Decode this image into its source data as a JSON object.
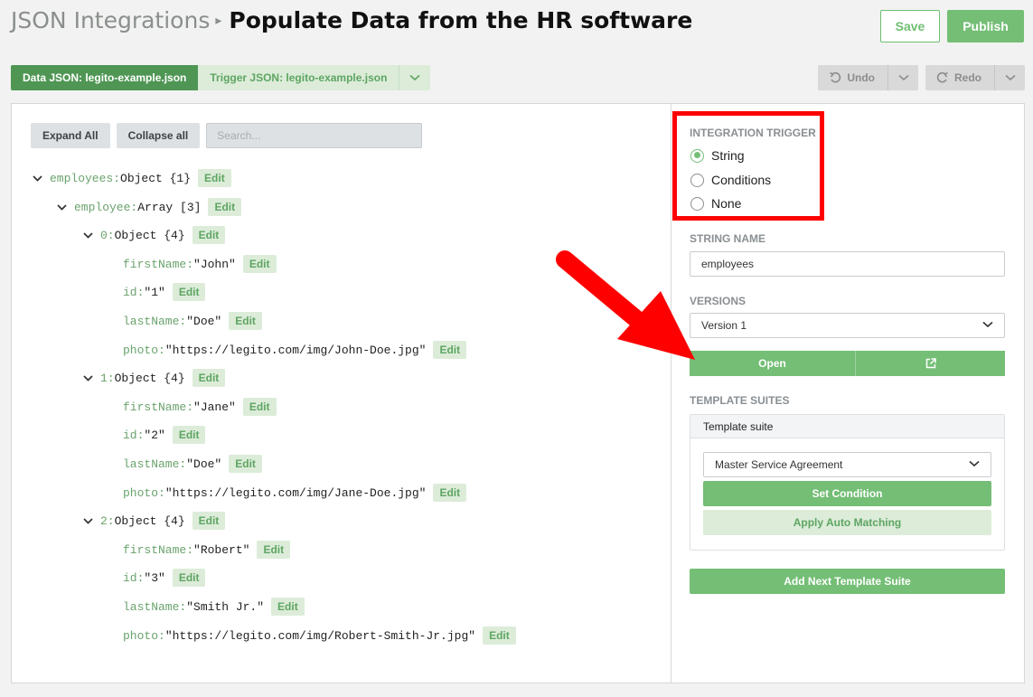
{
  "header": {
    "breadcrumb": "JSON Integrations",
    "title": "Populate Data from the HR software",
    "save_label": "Save",
    "publish_label": "Publish"
  },
  "tabs": [
    {
      "label": "Data JSON: legito-example.json",
      "active": true
    },
    {
      "label": "Trigger JSON: legito-example.json",
      "active": false
    }
  ],
  "toolbar": {
    "undo_label": "Undo",
    "redo_label": "Redo"
  },
  "tree_toolbar": {
    "expand_all": "Expand All",
    "collapse_all": "Collapse all",
    "search_placeholder": "Search..."
  },
  "tree": {
    "edit_label": "Edit",
    "nodes": [
      {
        "key": "employees:",
        "value": "Object {1}",
        "depth": 0,
        "chevron": true
      },
      {
        "key": "employee:",
        "value": "Array [3]",
        "depth": 1,
        "chevron": true
      },
      {
        "key": "0:",
        "value": "Object {4}",
        "depth": 2,
        "chevron": true
      },
      {
        "key": "firstName:",
        "value": "\"John\"",
        "depth": 3,
        "chevron": false
      },
      {
        "key": "id:",
        "value": "\"1\"",
        "depth": 3,
        "chevron": false
      },
      {
        "key": "lastName:",
        "value": "\"Doe\"",
        "depth": 3,
        "chevron": false
      },
      {
        "key": "photo:",
        "value": "\"https://legito.com/img/John-Doe.jpg\"",
        "depth": 3,
        "chevron": false
      },
      {
        "key": "1:",
        "value": "Object {4}",
        "depth": 2,
        "chevron": true
      },
      {
        "key": "firstName:",
        "value": "\"Jane\"",
        "depth": 3,
        "chevron": false
      },
      {
        "key": "id:",
        "value": "\"2\"",
        "depth": 3,
        "chevron": false
      },
      {
        "key": "lastName:",
        "value": "\"Doe\"",
        "depth": 3,
        "chevron": false
      },
      {
        "key": "photo:",
        "value": "\"https://legito.com/img/Jane-Doe.jpg\"",
        "depth": 3,
        "chevron": false
      },
      {
        "key": "2:",
        "value": "Object {4}",
        "depth": 2,
        "chevron": true
      },
      {
        "key": "firstName:",
        "value": "\"Robert\"",
        "depth": 3,
        "chevron": false
      },
      {
        "key": "id:",
        "value": "\"3\"",
        "depth": 3,
        "chevron": false
      },
      {
        "key": "lastName:",
        "value": "\"Smith Jr.\"",
        "depth": 3,
        "chevron": false
      },
      {
        "key": "photo:",
        "value": "\"https://legito.com/img/Robert-Smith-Jr.jpg\"",
        "depth": 3,
        "chevron": false
      }
    ]
  },
  "integration_trigger": {
    "label": "INTEGRATION TRIGGER",
    "options": [
      {
        "label": "String",
        "selected": true
      },
      {
        "label": "Conditions",
        "selected": false
      },
      {
        "label": "None",
        "selected": false
      }
    ]
  },
  "string_name": {
    "label": "STRING NAME",
    "value": "employees"
  },
  "versions": {
    "label": "VERSIONS",
    "selected": "Version 1",
    "open_label": "Open"
  },
  "template_suites": {
    "label": "TEMPLATE SUITES",
    "suite_title": "Template suite",
    "selected": "Master Service Agreement",
    "set_condition": "Set Condition",
    "auto_matching": "Apply Auto Matching",
    "add_next": "Add Next Template Suite"
  },
  "colors": {
    "accent": "#74be76",
    "accent_dark": "#4f9654",
    "annotation": "#ff0000"
  },
  "icons": {
    "undo": "undo-icon",
    "redo": "redo-icon",
    "external": "external-link-icon",
    "chevron": "chevron-down-icon"
  }
}
